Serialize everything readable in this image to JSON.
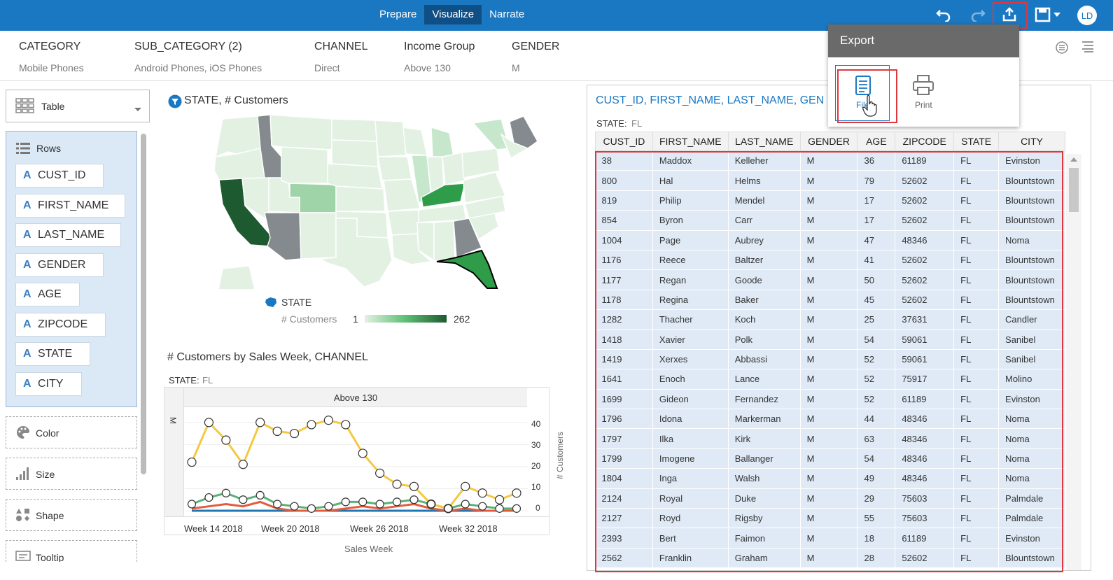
{
  "nav": {
    "tabs": [
      "Prepare",
      "Visualize",
      "Narrate"
    ],
    "active": "Visualize"
  },
  "user": {
    "initials": "LD"
  },
  "filters": [
    {
      "name": "CATEGORY",
      "value": "Mobile Phones"
    },
    {
      "name": "SUB_CATEGORY (2)",
      "value": "Android Phones, iOS Phones"
    },
    {
      "name": "CHANNEL",
      "value": "Direct"
    },
    {
      "name": "Income Group",
      "value": "Above 130"
    },
    {
      "name": "GENDER",
      "value": "M"
    }
  ],
  "left": {
    "viz_type": "Table",
    "rows_label": "Rows",
    "row_fields": [
      "CUST_ID",
      "FIRST_NAME",
      "LAST_NAME",
      "GENDER",
      "AGE",
      "ZIPCODE",
      "STATE",
      "CITY"
    ],
    "drops": [
      "Color",
      "Size",
      "Shape",
      "Tooltip"
    ]
  },
  "map": {
    "title": "STATE, # Customers",
    "legend_state": "STATE",
    "legend_measure": "# Customers",
    "legend_min": "1",
    "legend_max": "262",
    "colors": {
      "light": "#e3f1e3",
      "mid": "#9fd3a8",
      "dark": "#1e5a2f",
      "gray": "#858a8f",
      "bright": "#2e9c48"
    }
  },
  "line_chart": {
    "title": "# Customers by Sales Week, CHANNEL",
    "filter_label": "STATE:",
    "filter_value": "FL",
    "header": "Above 130",
    "row_label": "M",
    "x_title": "Sales Week",
    "y_title": "# Customers",
    "x_ticks": [
      "Week 14 2018",
      "Week 20 2018",
      "Week 26 2018",
      "Week 32 2018"
    ],
    "y_ticks": [
      "40",
      "30",
      "20",
      "10",
      "0"
    ]
  },
  "chart_data": {
    "type": "line",
    "title": "# Customers by Sales Week, CHANNEL",
    "xlabel": "Sales Week",
    "ylabel": "# Customers",
    "ylim": [
      0,
      45
    ],
    "x_ticks": [
      "Week 14 2018",
      "Week 20 2018",
      "Week 26 2018",
      "Week 32 2018"
    ],
    "series": [
      {
        "color": "#f5c842",
        "values": [
          22,
          40,
          32,
          21,
          40,
          36,
          35,
          39,
          41,
          39,
          26,
          17,
          12,
          11,
          3,
          1,
          11,
          8,
          5,
          8
        ]
      },
      {
        "color": "#5ab07a",
        "values": [
          3,
          6,
          8,
          5,
          7,
          3,
          2,
          1,
          2,
          4,
          4,
          3,
          4,
          5,
          3,
          1,
          3,
          2,
          1,
          1
        ]
      },
      {
        "color": "#e45b3c",
        "values": [
          1,
          2,
          3,
          2,
          4,
          1,
          0,
          0,
          0,
          1,
          2,
          1,
          2,
          3,
          1,
          0,
          1,
          0,
          0,
          0
        ]
      },
      {
        "color": "#1f77b4",
        "values": [
          0,
          0,
          0,
          0,
          0,
          0,
          0,
          0,
          0,
          0,
          0,
          0,
          0,
          0,
          0,
          0,
          0,
          0,
          0,
          0
        ]
      },
      {
        "color": "#8c4ac9",
        "values": [
          0,
          0,
          0,
          0,
          0,
          0,
          0,
          0,
          0,
          0,
          0,
          0,
          0,
          0,
          0,
          0,
          0,
          0,
          0,
          0
        ]
      }
    ]
  },
  "table": {
    "title": "CUST_ID, FIRST_NAME, LAST_NAME, GEN",
    "filter_label": "STATE:",
    "filter_value": "FL",
    "columns": [
      "CUST_ID",
      "FIRST_NAME",
      "LAST_NAME",
      "GENDER",
      "AGE",
      "ZIPCODE",
      "STATE",
      "CITY"
    ],
    "rows": [
      [
        "38",
        "Maddox",
        "Kelleher",
        "M",
        "36",
        "61189",
        "FL",
        "Evinston"
      ],
      [
        "800",
        "Hal",
        "Helms",
        "M",
        "79",
        "52602",
        "FL",
        "Blountstown"
      ],
      [
        "819",
        "Philip",
        "Mendel",
        "M",
        "17",
        "52602",
        "FL",
        "Blountstown"
      ],
      [
        "854",
        "Byron",
        "Carr",
        "M",
        "17",
        "52602",
        "FL",
        "Blountstown"
      ],
      [
        "1004",
        "Page",
        "Aubrey",
        "M",
        "47",
        "48346",
        "FL",
        "Noma"
      ],
      [
        "1176",
        "Reece",
        "Baltzer",
        "M",
        "41",
        "52602",
        "FL",
        "Blountstown"
      ],
      [
        "1177",
        "Regan",
        "Goode",
        "M",
        "50",
        "52602",
        "FL",
        "Blountstown"
      ],
      [
        "1178",
        "Regina",
        "Baker",
        "M",
        "45",
        "52602",
        "FL",
        "Blountstown"
      ],
      [
        "1282",
        "Thacher",
        "Koch",
        "M",
        "25",
        "37631",
        "FL",
        "Candler"
      ],
      [
        "1418",
        "Xavier",
        "Polk",
        "M",
        "54",
        "59061",
        "FL",
        "Sanibel"
      ],
      [
        "1419",
        "Xerxes",
        "Abbassi",
        "M",
        "52",
        "59061",
        "FL",
        "Sanibel"
      ],
      [
        "1641",
        "Enoch",
        "Lance",
        "M",
        "52",
        "75917",
        "FL",
        "Molino"
      ],
      [
        "1699",
        "Gideon",
        "Fernandez",
        "M",
        "52",
        "61189",
        "FL",
        "Evinston"
      ],
      [
        "1796",
        "Idona",
        "Markerman",
        "M",
        "44",
        "48346",
        "FL",
        "Noma"
      ],
      [
        "1797",
        "Ilka",
        "Kirk",
        "M",
        "63",
        "48346",
        "FL",
        "Noma"
      ],
      [
        "1799",
        "Imogene",
        "Ballanger",
        "M",
        "54",
        "48346",
        "FL",
        "Noma"
      ],
      [
        "1804",
        "Inga",
        "Walsh",
        "M",
        "49",
        "48346",
        "FL",
        "Noma"
      ],
      [
        "2124",
        "Royal",
        "Duke",
        "M",
        "29",
        "75603",
        "FL",
        "Palmdale"
      ],
      [
        "2127",
        "Royd",
        "Rigsby",
        "M",
        "55",
        "75603",
        "FL",
        "Palmdale"
      ],
      [
        "2393",
        "Bert",
        "Faimon",
        "M",
        "18",
        "61189",
        "FL",
        "Evinston"
      ],
      [
        "2562",
        "Franklin",
        "Graham",
        "M",
        "28",
        "52602",
        "FL",
        "Blountstown"
      ]
    ]
  },
  "export_popup": {
    "title": "Export",
    "file_label": "File",
    "print_label": "Print"
  },
  "accent": "#1a78c2",
  "highlight": "#e0373c"
}
